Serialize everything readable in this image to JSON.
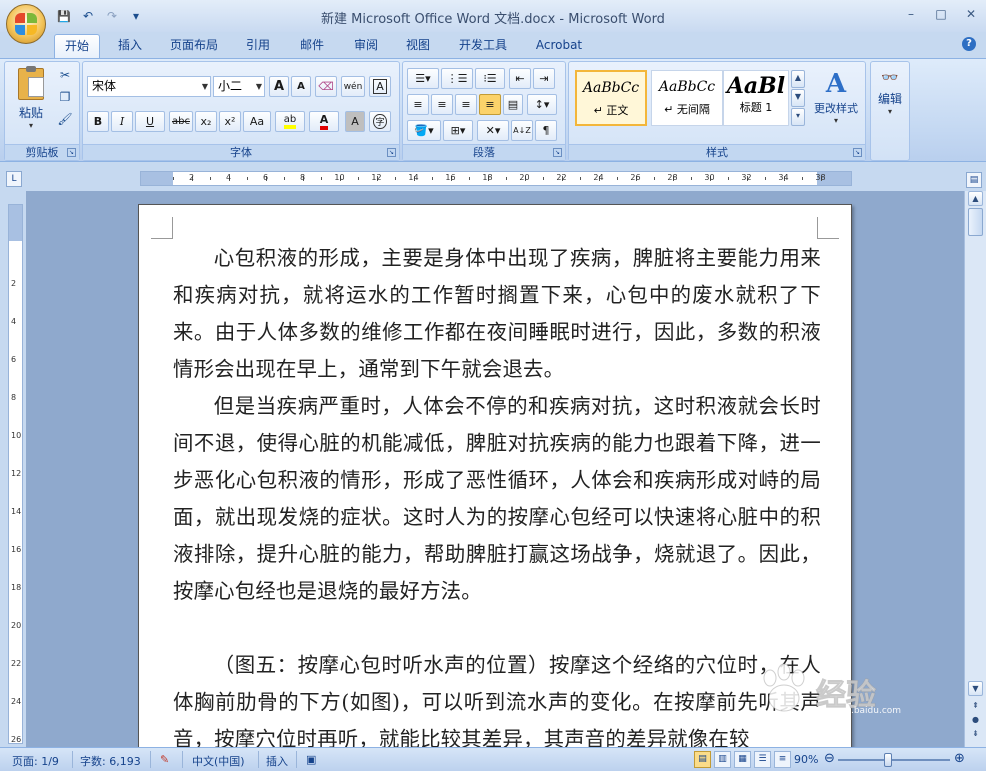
{
  "window": {
    "title": "新建 Microsoft Office Word 文档.docx - Microsoft Word",
    "minimize": "–",
    "maximize": "□",
    "close": "✕"
  },
  "qat": {
    "save": "💾",
    "undo": "↶",
    "redo": "↷",
    "customize": "▾"
  },
  "tabs": [
    "开始",
    "插入",
    "页面布局",
    "引用",
    "邮件",
    "审阅",
    "视图",
    "开发工具",
    "Acrobat"
  ],
  "help": "?",
  "ribbon": {
    "clipboard": {
      "label": "剪贴板",
      "paste": "粘贴",
      "paste_arrow": "▾"
    },
    "font": {
      "label": "字体",
      "font_name": "宋体",
      "font_size": "小二",
      "grow": "A",
      "shrink": "A",
      "clear": "⌫",
      "phonetic": "wén",
      "border_char": "A",
      "bold": "B",
      "italic": "I",
      "underline": "U",
      "strike": "abc",
      "subscript": "x₂",
      "superscript": "x²",
      "change_case": "Aa",
      "highlight": "ab",
      "font_color": "A",
      "char_shading": "A",
      "enclose": "字"
    },
    "paragraph": {
      "label": "段落",
      "sort": "A↓Z",
      "show_marks": "¶",
      "line_spacing": "↕"
    },
    "styles": {
      "label": "样式",
      "items": [
        {
          "sample": "AaBbCc",
          "name": "↵ 正文"
        },
        {
          "sample": "AaBbCc",
          "name": "↵ 无间隔"
        },
        {
          "sample": "AaBl",
          "name": "标题 1"
        }
      ],
      "change_styles": "更改样式",
      "change_arrow": "▾"
    },
    "editing": {
      "label": "编辑",
      "arrow": "▾"
    }
  },
  "ruler": {
    "corner": "L",
    "labels": [
      "2",
      "4",
      "6",
      "8",
      "10",
      "12",
      "14",
      "16",
      "18",
      "20",
      "22",
      "24",
      "26",
      "28",
      "30",
      "32",
      "34",
      "38"
    ],
    "vlabels": [
      "2",
      "4",
      "6",
      "8",
      "10",
      "12",
      "14",
      "16",
      "18",
      "20",
      "22",
      "24",
      "26"
    ]
  },
  "document": {
    "paragraphs": [
      "心包积液的形成，主要是身体中出现了疾病，脾脏将主要能力用来和疾病对抗，就将运水的工作暂时搁置下来，心包中的废水就积了下来。由于人体多数的维修工作都在夜间睡眠时进行，因此，多数的积液情形会出现在早上，通常到下午就会退去。",
      "但是当疾病严重时，人体会不停的和疾病对抗，这时积液就会长时间不退，使得心脏的机能减低，脾脏对抗疾病的能力也跟着下降，进一步恶化心包积液的情形，形成了恶性循环，人体会和疾病形成对峙的局面，就出现发烧的症状。这时人为的按摩心包经可以快速将心脏中的积液排除，提升心脏的能力，帮助脾脏打赢这场战争，烧就退了。因此，按摩心包经也是退烧的最好方法。",
      "（图五：按摩心包时听水声的位置）按摩这个经络的穴位时，在人体胸前肋骨的下方(如图)，可以听到流水声的变化。在按摩前先听其声音，按摩穴位时再听，就能比较其差异，其声音的差异就像在较"
    ]
  },
  "watermark": {
    "text": "经验",
    "url": "jingyan.baidu.com"
  },
  "status": {
    "page": "页面: 1/9",
    "words": "字数: 6,193",
    "language": "中文(中国)",
    "mode": "插入",
    "zoom": "90%",
    "zoom_level": 0.45
  },
  "colors": {
    "accent": "#15428b",
    "highlight": "#f3b63a"
  }
}
